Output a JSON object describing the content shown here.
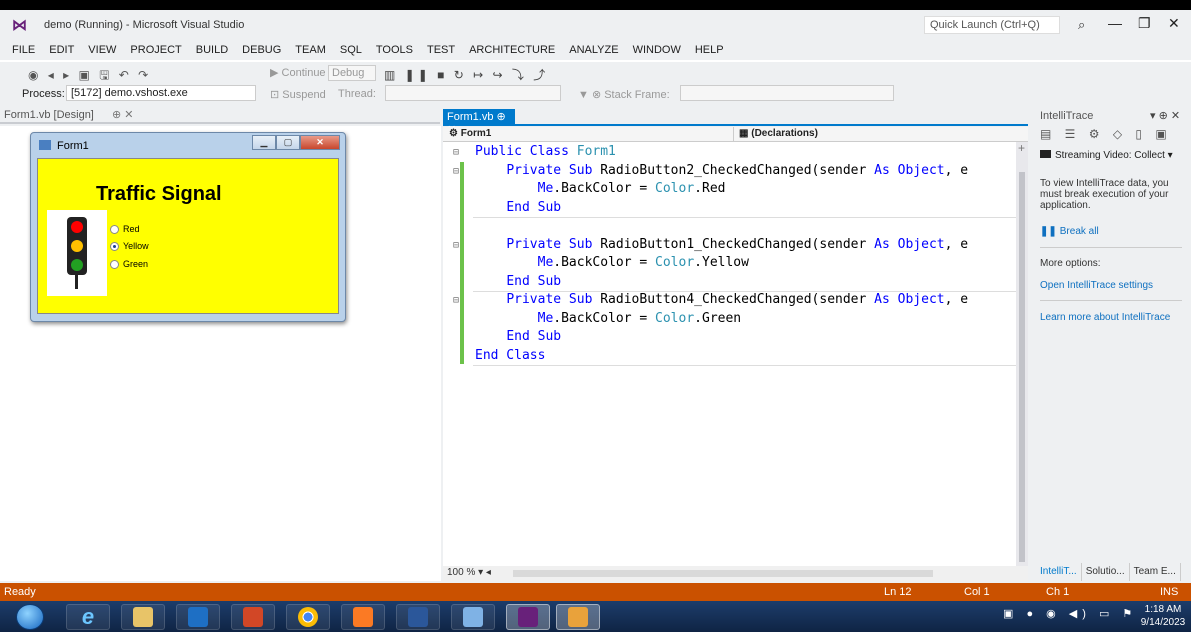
{
  "window": {
    "title": "demo (Running) - Microsoft Visual Studio",
    "quick_launch_placeholder": "Quick Launch (Ctrl+Q)"
  },
  "menu": [
    "FILE",
    "EDIT",
    "VIEW",
    "PROJECT",
    "BUILD",
    "DEBUG",
    "TEAM",
    "SQL",
    "TOOLS",
    "TEST",
    "ARCHITECTURE",
    "ANALYZE",
    "WINDOW",
    "HELP"
  ],
  "toolbar": {
    "continue_label": "Continue",
    "config_value": "Debug",
    "process_label": "Process:",
    "process_value": "[5172] demo.vshost.exe",
    "suspend_label": "Suspend",
    "thread_label": "Thread:",
    "stack_frame_label": "Stack Frame:"
  },
  "designer": {
    "tab_label": "Form1.vb [Design]",
    "form": {
      "title": "Form1",
      "heading": "Traffic Signal",
      "back_color": "#ffff00",
      "lights": [
        "#ff0000",
        "#ffc000",
        "#22a022"
      ],
      "radios": [
        {
          "label": "Red",
          "checked": false
        },
        {
          "label": "Yellow",
          "checked": true
        },
        {
          "label": "Green",
          "checked": false
        }
      ]
    }
  },
  "editor": {
    "tab_label": "Form1.vb",
    "nav_left": "Form1",
    "nav_right": "(Declarations)",
    "zoom": "100 %",
    "lines": [
      {
        "k1": "",
        "k2": "Public Class",
        "t": " Form1",
        "rest": ""
      },
      {
        "k1": "    ",
        "k2": "Private Sub",
        "t": "",
        "rest": " RadioButton2_CheckedChanged(sender As Object, e"
      },
      {
        "k1": "        ",
        "k2": "",
        "t": "",
        "rest": "Me.BackColor = Color.Red"
      },
      {
        "k1": "    ",
        "k2": "End Sub",
        "t": "",
        "rest": ""
      },
      {
        "k1": "",
        "k2": "",
        "t": "",
        "rest": ""
      },
      {
        "k1": "    ",
        "k2": "Private Sub",
        "t": "",
        "rest": " RadioButton1_CheckedChanged(sender As Object, e"
      },
      {
        "k1": "        ",
        "k2": "",
        "t": "",
        "rest": "Me.BackColor = Color.Yellow"
      },
      {
        "k1": "    ",
        "k2": "End Sub",
        "t": "",
        "rest": ""
      },
      {
        "k1": "    ",
        "k2": "Private Sub",
        "t": "",
        "rest": " RadioButton4_CheckedChanged(sender As Object, e"
      },
      {
        "k1": "        ",
        "k2": "",
        "t": "",
        "rest": "Me.BackColor = Color.Green"
      },
      {
        "k1": "    ",
        "k2": "End Sub",
        "t": "",
        "rest": ""
      },
      {
        "k1": "",
        "k2": "End Class",
        "t": "",
        "rest": ""
      }
    ]
  },
  "intellitrace": {
    "title": "IntelliTrace",
    "stream": "Streaming Video: Collect",
    "info": "To view IntelliTrace data, you must break execution of your application.",
    "break_all": "Break all",
    "more_options": "More options:",
    "open_settings": "Open IntelliTrace settings",
    "learn_more": "Learn more about IntelliTrace",
    "bottom_tabs": [
      "IntelliT...",
      "Solutio...",
      "Team E..."
    ]
  },
  "status": {
    "ready": "Ready",
    "ln": "Ln 12",
    "col": "Col 1",
    "ch": "Ch 1",
    "mode": "INS"
  },
  "taskbar": {
    "time": "1:18 AM",
    "date": "9/14/2023"
  }
}
